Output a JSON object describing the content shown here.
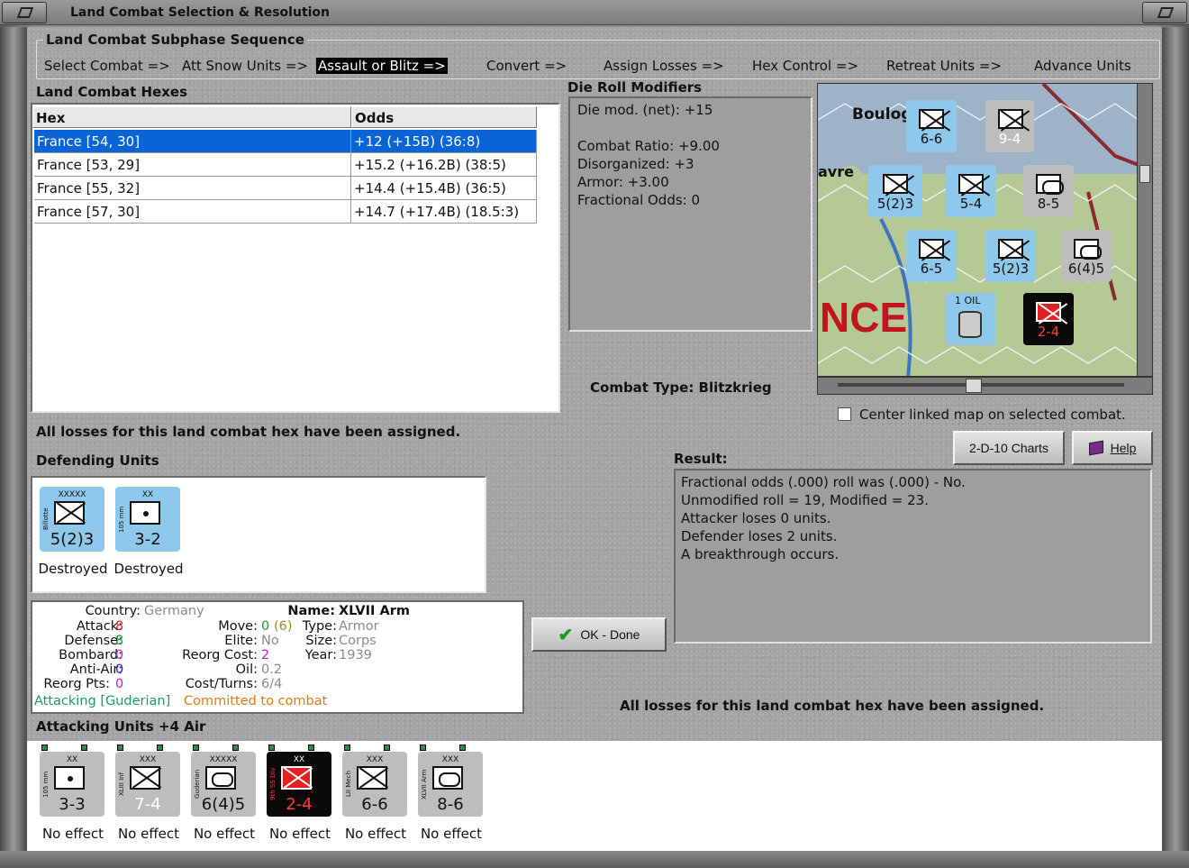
{
  "window": {
    "title": "Land Combat Selection & Resolution"
  },
  "sequence": {
    "label": "Land Combat Subphase Sequence",
    "steps": [
      "Select Combat =>",
      "Att Snow Units =>",
      "Assault or Blitz =>",
      "Convert =>",
      "Assign Losses =>",
      "Hex Control =>",
      "Retreat Units =>",
      "Advance Units"
    ]
  },
  "hexes": {
    "label": "Land Combat Hexes",
    "columns": [
      "Hex",
      "Odds"
    ],
    "rows": [
      {
        "hex": "France [54, 30]",
        "odds": "+12 (+15B) (36:8)",
        "selected": true
      },
      {
        "hex": "France [53, 29]",
        "odds": "+15.2 (+16.2B) (38:5)",
        "selected": false
      },
      {
        "hex": "France [55, 32]",
        "odds": "+14.4 (+15.4B) (36:5)",
        "selected": false
      },
      {
        "hex": "France [57, 30]",
        "odds": "+14.7 (+17.4B) (18.5:3)",
        "selected": false
      }
    ]
  },
  "modifiers": {
    "label": "Die Roll Modifiers",
    "lines": [
      "Die mod. (net): +15",
      "",
      "Combat Ratio: +9.00",
      "Disorganized: +3",
      "Armor: +3.00",
      "Fractional Odds: 0"
    ]
  },
  "combat_type": "Combat Type:  Blitzkrieg",
  "center_map_label": "Center linked map on selected combat.",
  "losses_msg": "All losses for this land combat hex have been assigned.",
  "buttons": {
    "charts": "2-D-10 Charts",
    "help": "Help",
    "ok": "OK - Done"
  },
  "result": {
    "label": "Result:",
    "lines": [
      "Fractional odds (.000) roll was (.000)  - No.",
      "Unmodified roll = 19, Modified = 23.",
      "Attacker loses 0 units.",
      "Defender loses 2 units.",
      "A breakthrough occurs."
    ]
  },
  "defending": {
    "label": "Defending Units",
    "units": [
      {
        "size": "XXXXX",
        "name": "Billotte",
        "value": "5(2)3",
        "status": "Destroyed",
        "symbol": "x",
        "color": "blue"
      },
      {
        "size": "XX",
        "name": "105 mm",
        "value": "3-2",
        "status": "Destroyed",
        "symbol": "dot",
        "color": "blue"
      }
    ]
  },
  "unit_info": {
    "country_label": "Country:",
    "country": "Germany",
    "attack_label": "Attack:",
    "attack": "8",
    "defense_label": "Defense:",
    "defense": "8",
    "bombard_label": "Bombard:",
    "bombard": "0",
    "antiair_label": "Anti-Air:",
    "antiair": "0",
    "reorg_label": "Reorg Pts:",
    "reorg": "0",
    "move_label": "Move:",
    "move": "0",
    "move_extra": "(6)",
    "elite_label": "Elite:",
    "elite": "No",
    "reorgcost_label": "Reorg Cost:",
    "reorgcost": "2",
    "oil_label": "Oil:",
    "oil": "0.2",
    "cost_label": "Cost/Turns:",
    "cost": "6/4",
    "name_label": "Name:",
    "name": "XLVII Arm",
    "type_label": "Type:",
    "type": "Armor",
    "size_label": "Size:",
    "size": "Corps",
    "year_label": "Year:",
    "year": "1939",
    "attacking": "Attacking [Guderian]",
    "committed": "Committed to combat"
  },
  "attacking": {
    "label": "Attacking Units +4 Air",
    "units": [
      {
        "size": "XX",
        "name": "105 mm",
        "value": "3-3",
        "status": "No effect",
        "symbol": "dot",
        "color": "gray"
      },
      {
        "size": "XXX",
        "name": "XLIII Inf",
        "value": "7-4",
        "status": "No effect",
        "symbol": "x",
        "color": "gray"
      },
      {
        "size": "XXXXX",
        "name": "Guderian",
        "value": "6(4)5",
        "status": "No effect",
        "symbol": "oval",
        "color": "gray"
      },
      {
        "size": "XX",
        "name": "9th SS Div",
        "value": "2-4",
        "status": "No effect",
        "symbol": "x",
        "color": "black"
      },
      {
        "size": "XXX",
        "name": "LII Mech",
        "value": "6-6",
        "status": "No effect",
        "symbol": "x",
        "color": "gray"
      },
      {
        "size": "XXX",
        "name": "XLVII Arm",
        "value": "8-6",
        "status": "No effect",
        "symbol": "oval",
        "color": "gray"
      }
    ]
  },
  "map": {
    "labels": [
      "Boulog",
      "avre",
      "NCE"
    ],
    "oil_label": "1 OIL",
    "counters": [
      {
        "v": "6-6",
        "c": "blue"
      },
      {
        "v": "9-4",
        "c": "gray"
      },
      {
        "v": "5(2)3",
        "c": "blue"
      },
      {
        "v": "5-4",
        "c": "blue"
      },
      {
        "v": "8-5",
        "c": "gray"
      },
      {
        "v": "6-5",
        "c": "blue"
      },
      {
        "v": "5(2)3",
        "c": "blue"
      },
      {
        "v": "6(4)5",
        "c": "gray"
      },
      {
        "v": "2-4",
        "c": "black"
      }
    ]
  }
}
